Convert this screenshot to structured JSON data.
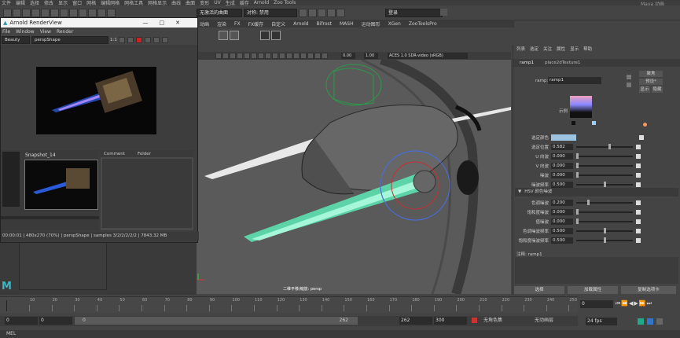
{
  "menu": [
    "文件",
    "编辑",
    "选择",
    "修改",
    "显示",
    "窗口",
    "网格",
    "编辑网格",
    "网格工具",
    "网格显示",
    "曲线",
    "曲面",
    "变形",
    "UV",
    "生成",
    "缓存",
    "Arnold",
    "Zoo Tools"
  ],
  "app_title": "Maya 动画",
  "shelf": {
    "workspace_dropdown": "无激活的曲面",
    "symmetry_dropdown": "对称: 禁用",
    "login": "登录",
    "tabs": [
      "动画",
      "渲染",
      "FX",
      "FX缓存",
      "自定义",
      "Arnold",
      "Bifrost",
      "MASH",
      "运动图形",
      "XGen",
      "ZooToolsPro"
    ]
  },
  "viewport": {
    "exposure": "0.00",
    "gamma": "1.00",
    "colorspace": "ACES 1.0 SDR-video (sRGB)",
    "camera_label": "二维平移/缩放: persp"
  },
  "render_view": {
    "title": "Arnold RenderView",
    "menu": [
      "File",
      "Window",
      "View",
      "Render"
    ],
    "aov": "Beauty",
    "camera": "perspShape",
    "zoom": "1:1",
    "snapshot_name": "Snapshot_14",
    "tabs": [
      "Comment",
      "Folder"
    ],
    "status": "00:00:01 | 480x270 (70%) | perspShape | samples 3/2/2/2/2/2 | 7843.32 MB"
  },
  "attr_editor": {
    "menu": [
      "列表",
      "选定",
      "关注",
      "属性",
      "显示",
      "帮助"
    ],
    "tabs": [
      "ramp1",
      "place2dTexture1"
    ],
    "node_label": "ramp:",
    "node_name": "ramp1",
    "focus_btn": "聚焦",
    "preset_btn": "预设*",
    "show_btn": "显示",
    "hide_btn": "隐藏",
    "swatch_label": "示例",
    "rows": [
      {
        "label": "选定颜色",
        "value": ""
      },
      {
        "label": "选定位置",
        "value": "0.582"
      },
      {
        "label": "U 向波",
        "value": "0.000"
      },
      {
        "label": "V 向波",
        "value": "0.000"
      },
      {
        "label": "噪波",
        "value": "0.000"
      },
      {
        "label": "噪波频率",
        "value": "0.500"
      }
    ],
    "hsv_section": "HSV 颜色噪波",
    "hsv_rows": [
      {
        "label": "色调噪波",
        "value": "0.200"
      },
      {
        "label": "饱和度噪波",
        "value": "0.000"
      },
      {
        "label": "值噪波",
        "value": "0.000"
      },
      {
        "label": "色调噪波频率",
        "value": "0.500"
      },
      {
        "label": "饱和度噪波频率",
        "value": "0.500"
      }
    ],
    "notes_label": "注释: ramp1",
    "bottom_buttons": [
      "选择",
      "加载属性",
      "复制选项卡"
    ]
  },
  "timeline": {
    "ticks": [
      "10",
      "20",
      "30",
      "40",
      "50",
      "60",
      "70",
      "80",
      "90",
      "100",
      "110",
      "120",
      "130",
      "140",
      "150",
      "160",
      "170",
      "180",
      "190",
      "200",
      "210",
      "220",
      "230",
      "240",
      "250"
    ],
    "start_outer": "0",
    "start_inner": "0",
    "slider_start": "0",
    "slider_end": "262",
    "end_inner": "262",
    "end_outer": "300",
    "current_frame": "0",
    "char_set": "无角色集",
    "anim_layer": "无动画层",
    "fps": "24 fps",
    "mel": "MEL"
  }
}
